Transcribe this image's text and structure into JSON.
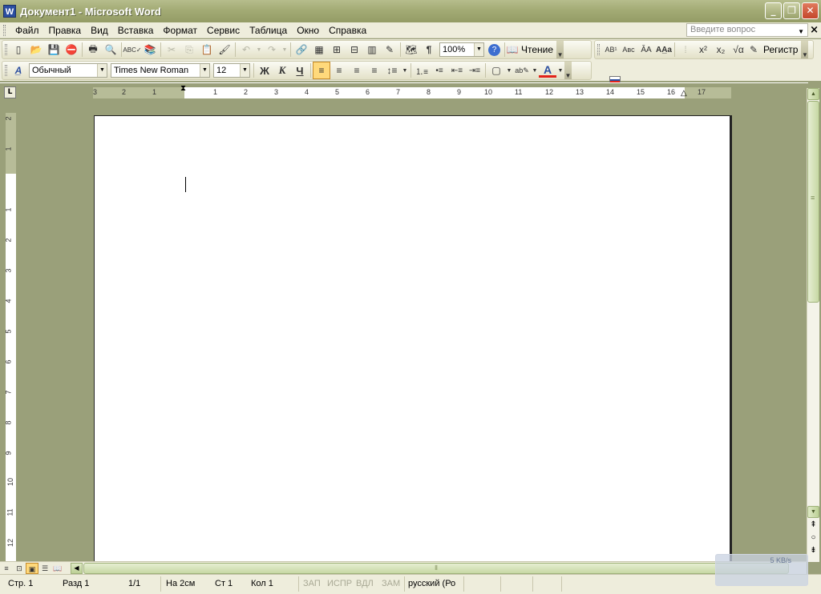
{
  "window": {
    "app_icon": "W",
    "title": "Документ1 - Microsoft Word",
    "minimize": "_",
    "maximize": "❐",
    "close": "✕"
  },
  "menu": {
    "items": [
      "Файл",
      "Правка",
      "Вид",
      "Вставка",
      "Формат",
      "Сервис",
      "Таблица",
      "Окно",
      "Справка"
    ],
    "help_placeholder": "Введите вопрос",
    "doc_close": "×"
  },
  "toolbar1": {
    "zoom": "100%",
    "reading_label": "Чтение",
    "register_label": "Регистр",
    "glyphs": {
      "new": "▯",
      "open": "📂",
      "save": "💾",
      "permission": "⛔",
      "print": "🖶",
      "preview": "🔍",
      "spelling": "ABC✓",
      "research": "📚",
      "cut": "✂",
      "copy": "⎘",
      "paste": "📋",
      "format_painter": "🖌",
      "undo": "↶",
      "redo": "↷",
      "hyperlink": "🔗",
      "tables_borders": "▦",
      "insert_table": "⊞",
      "insert_excel": "⊟",
      "columns": "▥",
      "drawing": "✎",
      "doc_map": "🗺",
      "show_hide": "¶",
      "help": "?",
      "ab1": "AB¹",
      "abc": "Aʙᴄ",
      "aa": "ǍA",
      "aa_case": "AA̲a",
      "superscript": "x²",
      "subscript": "x₂",
      "equation": "√α"
    }
  },
  "toolbar2": {
    "style": "Обычный",
    "font": "Times New Roman",
    "size": "12",
    "bold": "Ж",
    "italic": "К",
    "underline": "Ч",
    "font_color_letter": "A",
    "glyphs": {
      "styles": "A̲",
      "align_left": "≡",
      "align_center": "≡",
      "align_right": "≡",
      "justify": "≡",
      "line_spacing": "↕≡",
      "numbering": "⒈≡",
      "bullets": "•≡",
      "outdent": "⇤≡",
      "indent": "⇥≡",
      "borders": "▢",
      "highlight": "ab✎"
    }
  },
  "ruler": {
    "tab_selector": "L",
    "h_numbers": [
      "3",
      "2",
      "1",
      "1",
      "2",
      "3",
      "4",
      "5",
      "6",
      "7",
      "8",
      "9",
      "10",
      "11",
      "12",
      "13",
      "14",
      "15",
      "16",
      "17"
    ],
    "v_numbers": [
      "2",
      "1",
      "1",
      "2",
      "3",
      "4",
      "5",
      "6",
      "7",
      "8",
      "9",
      "10",
      "11",
      "12"
    ]
  },
  "view_buttons": [
    "≡",
    "⊡",
    "▣",
    "☰",
    "📖"
  ],
  "status": {
    "page": "Стр. 1",
    "section": "Разд 1",
    "pages": "1/1",
    "at": "На 2см",
    "line": "Ст 1",
    "column": "Кол 1",
    "rec": "ЗАП",
    "trk": "ИСПР",
    "ext": "ВДЛ",
    "ovr": "ЗАМ",
    "language": "русский (Ро"
  },
  "net_widget": {
    "speed": "5 KB/s"
  },
  "colors": {
    "font_color": "#e2231a",
    "active_button": "#ffd97b",
    "workspace": "#9aa07a"
  }
}
